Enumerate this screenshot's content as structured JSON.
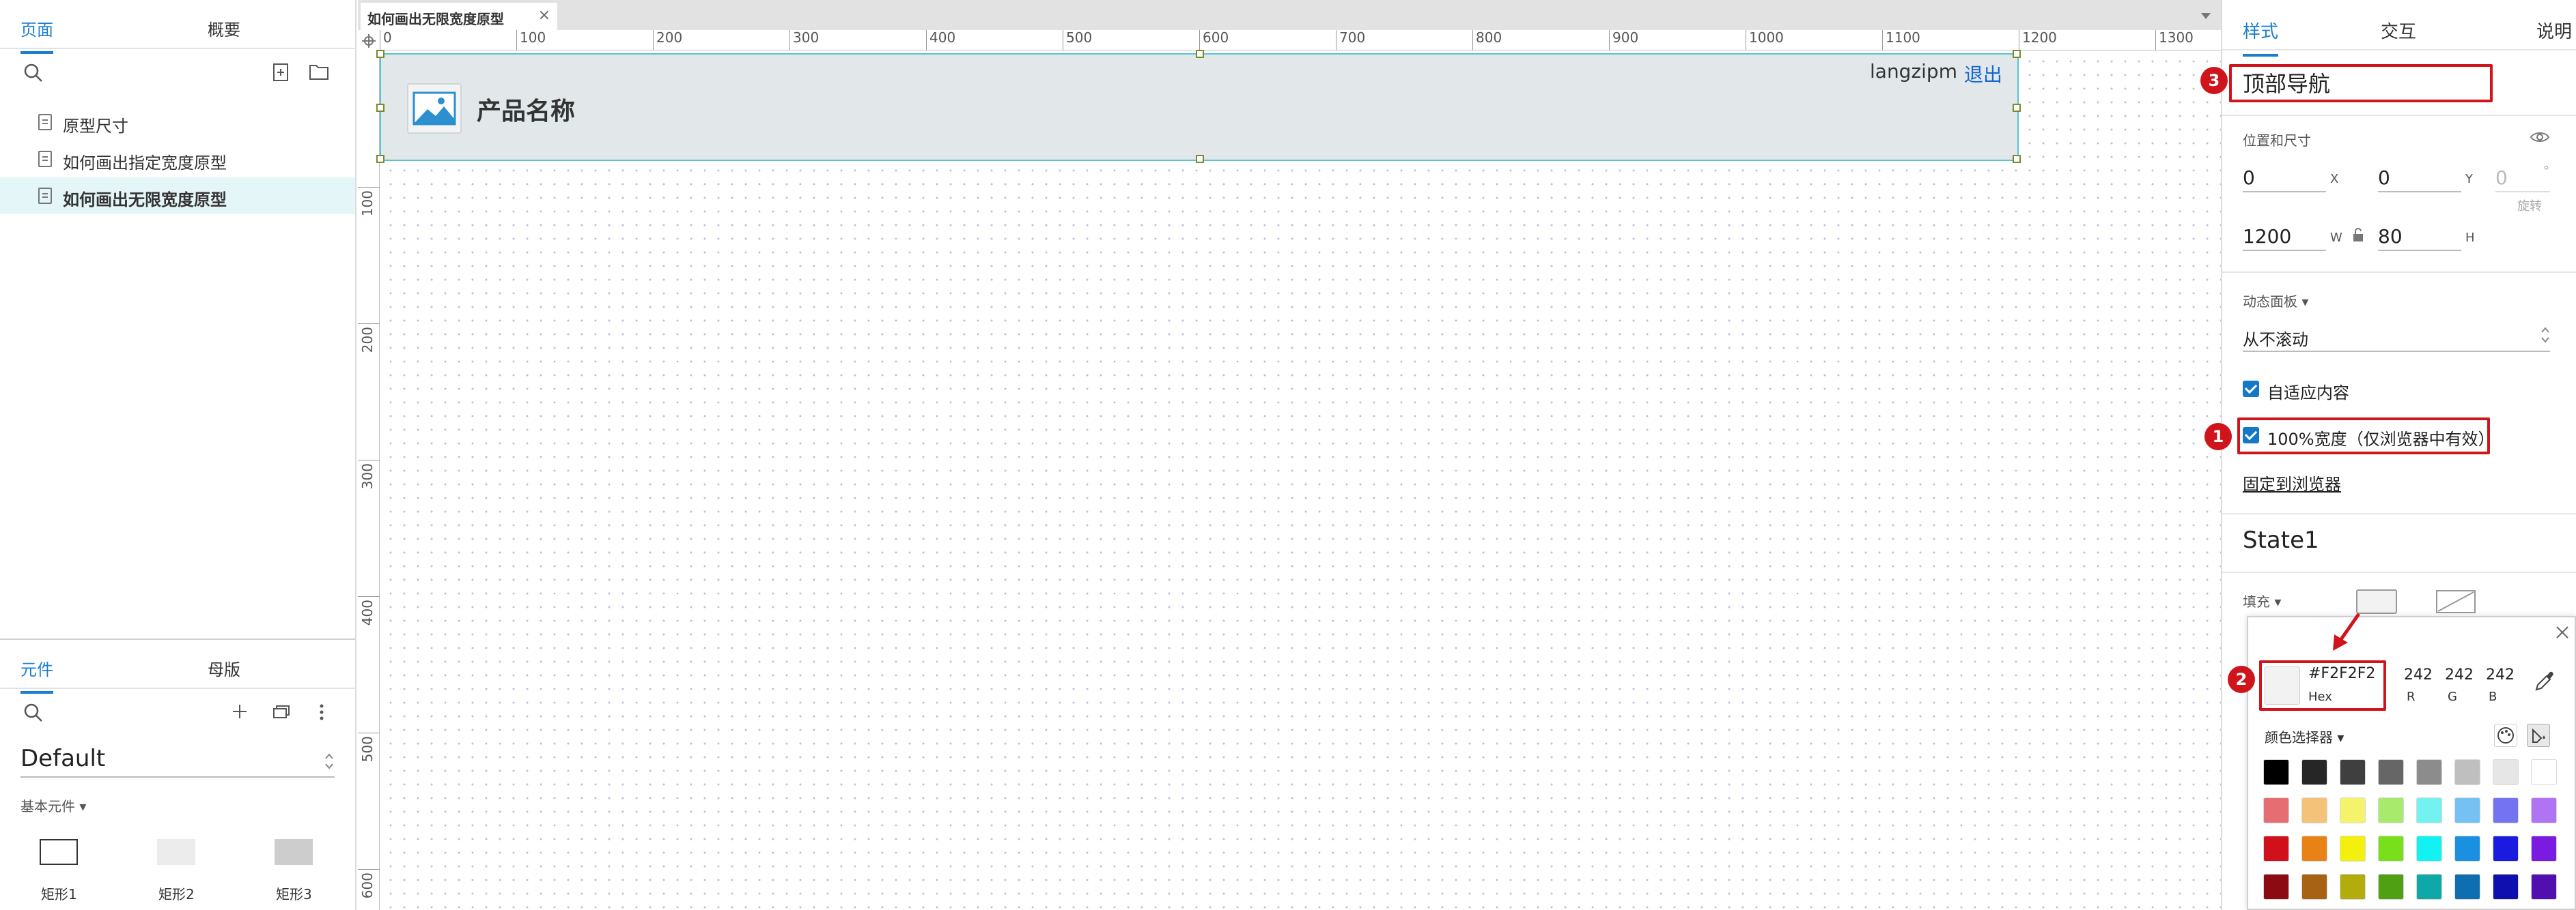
{
  "left_panel": {
    "pages_tab": "页面",
    "overview_tab": "概要",
    "pages": [
      {
        "label": "原型尺寸"
      },
      {
        "label": "如何画出指定宽度原型"
      },
      {
        "label": "如何画出无限宽度原型"
      }
    ],
    "widgets_tab": "元件",
    "masters_tab": "母版",
    "library": "Default",
    "category": "基本元件",
    "widgets": [
      "矩形1",
      "矩形2",
      "矩形3"
    ]
  },
  "canvas": {
    "tab_title": "如何画出无限宽度原型",
    "ruler_h": [
      "0",
      "100",
      "200",
      "300",
      "400",
      "500",
      "600",
      "700",
      "800",
      "900",
      "1000",
      "1100",
      "1200",
      "1300"
    ],
    "ruler_v": [
      "100",
      "200",
      "300",
      "400",
      "500",
      "600"
    ],
    "navbar": {
      "product_name": "产品名称",
      "username": "langzipm",
      "logout": "退出",
      "fill_color": "#F2F2F2"
    }
  },
  "right_panel": {
    "tabs": [
      "样式",
      "交互",
      "说明"
    ],
    "widget_name": "顶部导航",
    "position_size_label": "位置和尺寸",
    "x_value": "0",
    "x_label": "X",
    "y_value": "0",
    "y_label": "Y",
    "rotation_value": "0",
    "rotation_unit": "°",
    "rotation_label": "旋转",
    "w_value": "1200",
    "w_label": "W",
    "h_value": "80",
    "h_label": "H",
    "dynamic_panel_label": "动态面板",
    "scroll_value": "从不滚动",
    "fit_content_label": "自适应内容",
    "full_width_label": "100%宽度（仅浏览器中有效）",
    "pin_label": "固定到浏览器",
    "state_name": "State1",
    "fill_label": "填充",
    "annotations": [
      "1",
      "2",
      "3"
    ],
    "color_picker": {
      "hex_value": "#F2F2F2",
      "hex_label": "Hex",
      "r_value": "242",
      "r_label": "R",
      "g_value": "242",
      "g_label": "G",
      "b_value": "242",
      "b_label": "B",
      "picker_label": "颜色选择器",
      "swatches": [
        [
          "#000000",
          "#262626",
          "#3f3f3f",
          "#666666",
          "#8c8c8c",
          "#bfbfbf",
          "#e6e6e6",
          "#ffffff"
        ],
        [
          "#e66e73",
          "#f5c27a",
          "#f5f26b",
          "#a8ea6c",
          "#74f2f2",
          "#74c1f2",
          "#7474f2",
          "#b074f2"
        ],
        [
          "#d0111b",
          "#e98216",
          "#f3f00e",
          "#78e01a",
          "#13f2f2",
          "#1a90e0",
          "#1a1ae0",
          "#7b1ae0"
        ],
        [
          "#8c0a12",
          "#a86214",
          "#b2ad0d",
          "#4fa012",
          "#0ea8a8",
          "#0f6eb0",
          "#0f0fb0",
          "#510fb0"
        ]
      ]
    }
  }
}
